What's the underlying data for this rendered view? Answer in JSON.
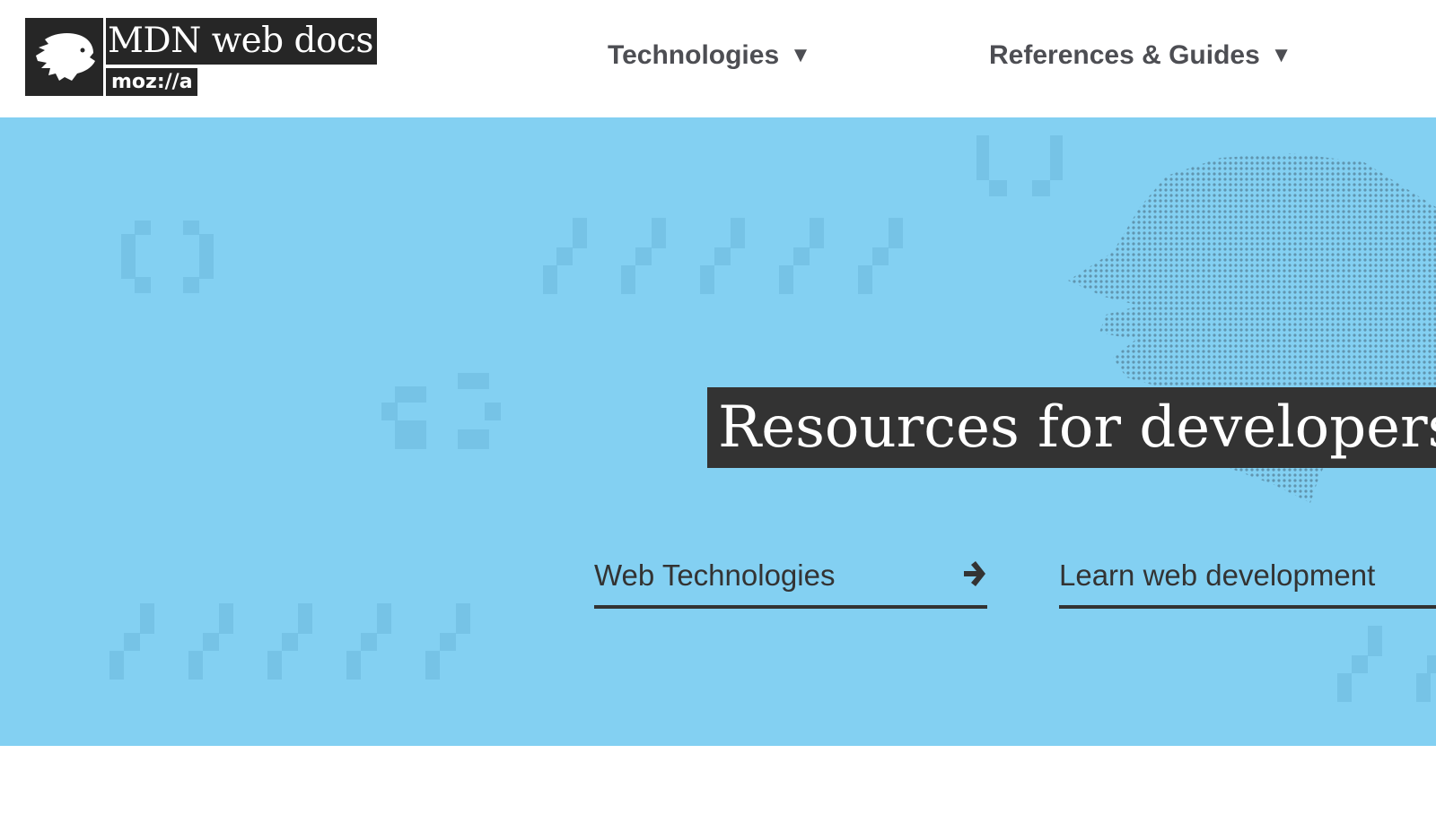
{
  "header": {
    "logo": {
      "wordmark": "MDN web docs",
      "brand": "moz://a"
    },
    "nav": [
      {
        "label": "Technologies",
        "caret": "▼"
      },
      {
        "label": "References & Guides",
        "caret": "▼"
      }
    ]
  },
  "hero": {
    "title": "Resources for developers,",
    "links": [
      {
        "label": "Web Technologies",
        "icon": "arrow-right-icon"
      },
      {
        "label": "Learn web development"
      }
    ]
  },
  "colors": {
    "hero_background": "#83d0f2",
    "dark": "#333333",
    "logo_background": "#262626",
    "nav_text": "#4d4e53"
  }
}
